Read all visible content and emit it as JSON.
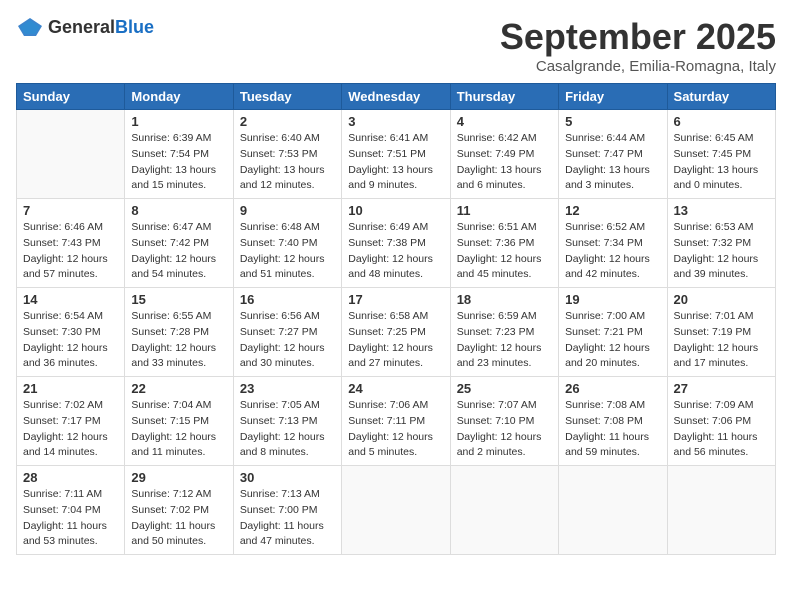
{
  "logo": {
    "general": "General",
    "blue": "Blue"
  },
  "title": "September 2025",
  "location": "Casalgrande, Emilia-Romagna, Italy",
  "weekdays": [
    "Sunday",
    "Monday",
    "Tuesday",
    "Wednesday",
    "Thursday",
    "Friday",
    "Saturday"
  ],
  "weeks": [
    [
      {
        "day": "",
        "sunrise": "",
        "sunset": "",
        "daylight": ""
      },
      {
        "day": "1",
        "sunrise": "Sunrise: 6:39 AM",
        "sunset": "Sunset: 7:54 PM",
        "daylight": "Daylight: 13 hours and 15 minutes."
      },
      {
        "day": "2",
        "sunrise": "Sunrise: 6:40 AM",
        "sunset": "Sunset: 7:53 PM",
        "daylight": "Daylight: 13 hours and 12 minutes."
      },
      {
        "day": "3",
        "sunrise": "Sunrise: 6:41 AM",
        "sunset": "Sunset: 7:51 PM",
        "daylight": "Daylight: 13 hours and 9 minutes."
      },
      {
        "day": "4",
        "sunrise": "Sunrise: 6:42 AM",
        "sunset": "Sunset: 7:49 PM",
        "daylight": "Daylight: 13 hours and 6 minutes."
      },
      {
        "day": "5",
        "sunrise": "Sunrise: 6:44 AM",
        "sunset": "Sunset: 7:47 PM",
        "daylight": "Daylight: 13 hours and 3 minutes."
      },
      {
        "day": "6",
        "sunrise": "Sunrise: 6:45 AM",
        "sunset": "Sunset: 7:45 PM",
        "daylight": "Daylight: 13 hours and 0 minutes."
      }
    ],
    [
      {
        "day": "7",
        "sunrise": "Sunrise: 6:46 AM",
        "sunset": "Sunset: 7:43 PM",
        "daylight": "Daylight: 12 hours and 57 minutes."
      },
      {
        "day": "8",
        "sunrise": "Sunrise: 6:47 AM",
        "sunset": "Sunset: 7:42 PM",
        "daylight": "Daylight: 12 hours and 54 minutes."
      },
      {
        "day": "9",
        "sunrise": "Sunrise: 6:48 AM",
        "sunset": "Sunset: 7:40 PM",
        "daylight": "Daylight: 12 hours and 51 minutes."
      },
      {
        "day": "10",
        "sunrise": "Sunrise: 6:49 AM",
        "sunset": "Sunset: 7:38 PM",
        "daylight": "Daylight: 12 hours and 48 minutes."
      },
      {
        "day": "11",
        "sunrise": "Sunrise: 6:51 AM",
        "sunset": "Sunset: 7:36 PM",
        "daylight": "Daylight: 12 hours and 45 minutes."
      },
      {
        "day": "12",
        "sunrise": "Sunrise: 6:52 AM",
        "sunset": "Sunset: 7:34 PM",
        "daylight": "Daylight: 12 hours and 42 minutes."
      },
      {
        "day": "13",
        "sunrise": "Sunrise: 6:53 AM",
        "sunset": "Sunset: 7:32 PM",
        "daylight": "Daylight: 12 hours and 39 minutes."
      }
    ],
    [
      {
        "day": "14",
        "sunrise": "Sunrise: 6:54 AM",
        "sunset": "Sunset: 7:30 PM",
        "daylight": "Daylight: 12 hours and 36 minutes."
      },
      {
        "day": "15",
        "sunrise": "Sunrise: 6:55 AM",
        "sunset": "Sunset: 7:28 PM",
        "daylight": "Daylight: 12 hours and 33 minutes."
      },
      {
        "day": "16",
        "sunrise": "Sunrise: 6:56 AM",
        "sunset": "Sunset: 7:27 PM",
        "daylight": "Daylight: 12 hours and 30 minutes."
      },
      {
        "day": "17",
        "sunrise": "Sunrise: 6:58 AM",
        "sunset": "Sunset: 7:25 PM",
        "daylight": "Daylight: 12 hours and 27 minutes."
      },
      {
        "day": "18",
        "sunrise": "Sunrise: 6:59 AM",
        "sunset": "Sunset: 7:23 PM",
        "daylight": "Daylight: 12 hours and 23 minutes."
      },
      {
        "day": "19",
        "sunrise": "Sunrise: 7:00 AM",
        "sunset": "Sunset: 7:21 PM",
        "daylight": "Daylight: 12 hours and 20 minutes."
      },
      {
        "day": "20",
        "sunrise": "Sunrise: 7:01 AM",
        "sunset": "Sunset: 7:19 PM",
        "daylight": "Daylight: 12 hours and 17 minutes."
      }
    ],
    [
      {
        "day": "21",
        "sunrise": "Sunrise: 7:02 AM",
        "sunset": "Sunset: 7:17 PM",
        "daylight": "Daylight: 12 hours and 14 minutes."
      },
      {
        "day": "22",
        "sunrise": "Sunrise: 7:04 AM",
        "sunset": "Sunset: 7:15 PM",
        "daylight": "Daylight: 12 hours and 11 minutes."
      },
      {
        "day": "23",
        "sunrise": "Sunrise: 7:05 AM",
        "sunset": "Sunset: 7:13 PM",
        "daylight": "Daylight: 12 hours and 8 minutes."
      },
      {
        "day": "24",
        "sunrise": "Sunrise: 7:06 AM",
        "sunset": "Sunset: 7:11 PM",
        "daylight": "Daylight: 12 hours and 5 minutes."
      },
      {
        "day": "25",
        "sunrise": "Sunrise: 7:07 AM",
        "sunset": "Sunset: 7:10 PM",
        "daylight": "Daylight: 12 hours and 2 minutes."
      },
      {
        "day": "26",
        "sunrise": "Sunrise: 7:08 AM",
        "sunset": "Sunset: 7:08 PM",
        "daylight": "Daylight: 11 hours and 59 minutes."
      },
      {
        "day": "27",
        "sunrise": "Sunrise: 7:09 AM",
        "sunset": "Sunset: 7:06 PM",
        "daylight": "Daylight: 11 hours and 56 minutes."
      }
    ],
    [
      {
        "day": "28",
        "sunrise": "Sunrise: 7:11 AM",
        "sunset": "Sunset: 7:04 PM",
        "daylight": "Daylight: 11 hours and 53 minutes."
      },
      {
        "day": "29",
        "sunrise": "Sunrise: 7:12 AM",
        "sunset": "Sunset: 7:02 PM",
        "daylight": "Daylight: 11 hours and 50 minutes."
      },
      {
        "day": "30",
        "sunrise": "Sunrise: 7:13 AM",
        "sunset": "Sunset: 7:00 PM",
        "daylight": "Daylight: 11 hours and 47 minutes."
      },
      {
        "day": "",
        "sunrise": "",
        "sunset": "",
        "daylight": ""
      },
      {
        "day": "",
        "sunrise": "",
        "sunset": "",
        "daylight": ""
      },
      {
        "day": "",
        "sunrise": "",
        "sunset": "",
        "daylight": ""
      },
      {
        "day": "",
        "sunrise": "",
        "sunset": "",
        "daylight": ""
      }
    ]
  ]
}
